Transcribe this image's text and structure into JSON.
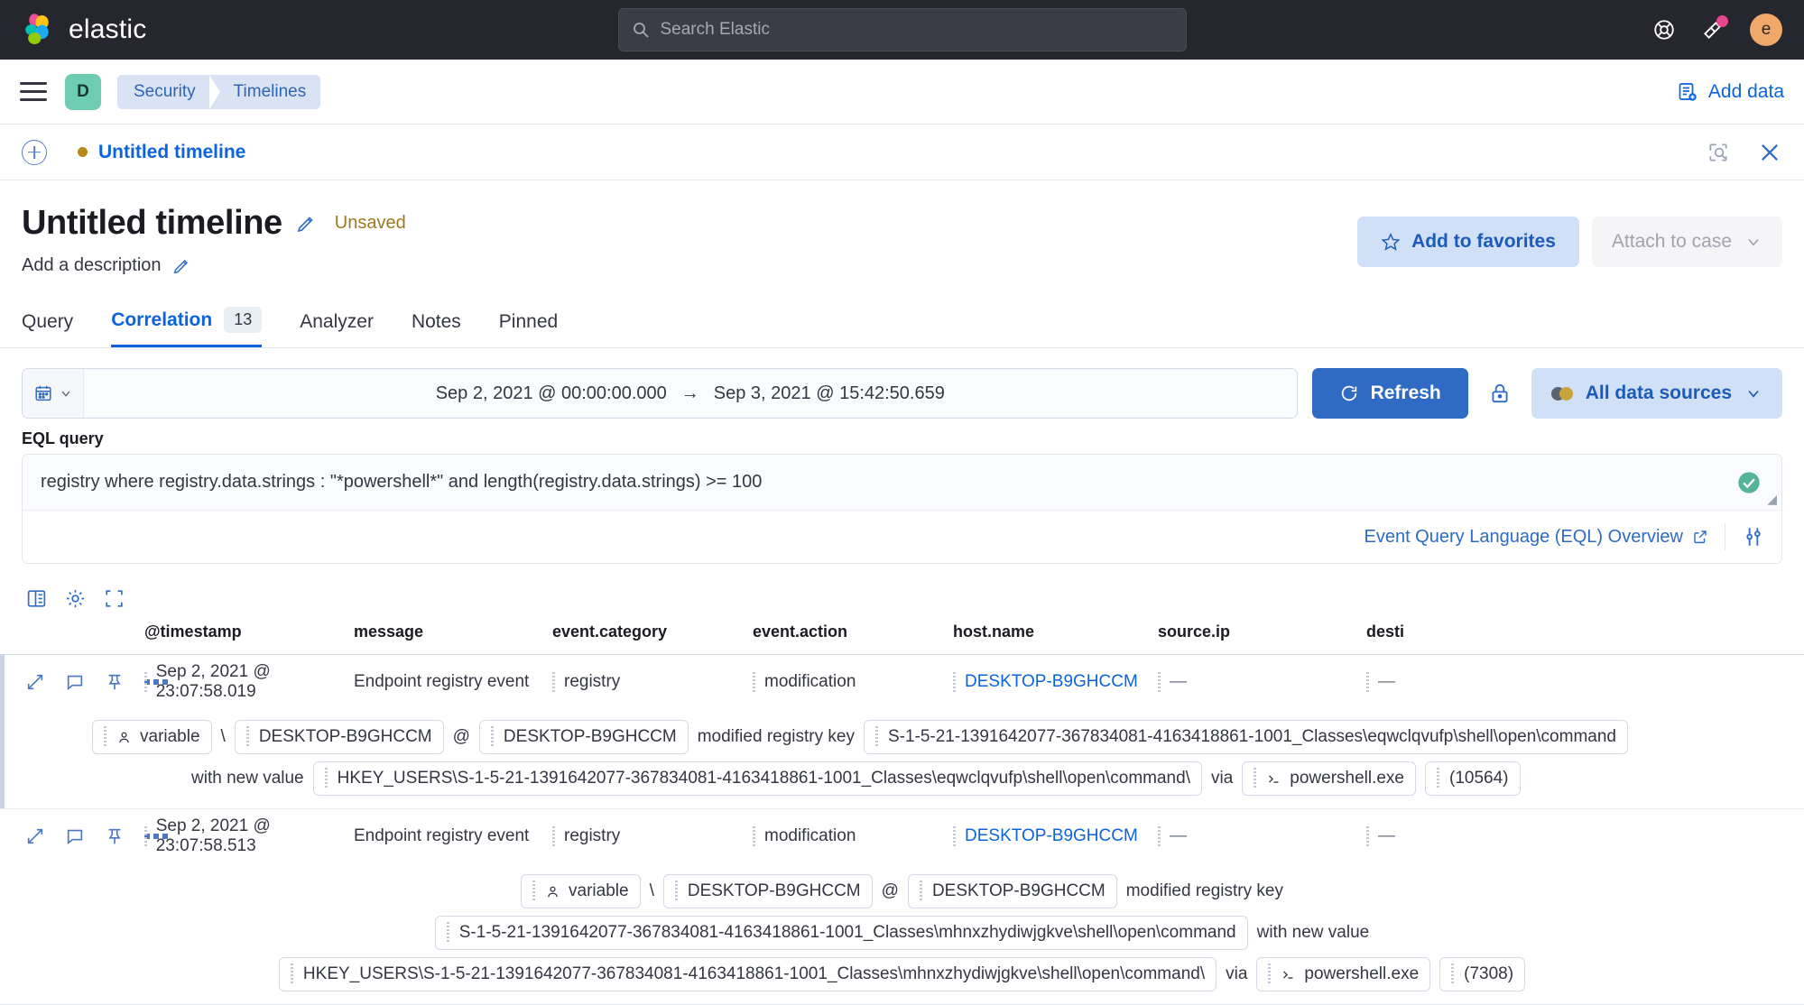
{
  "chrome": {
    "brand": "elastic",
    "search_placeholder": "Search Elastic",
    "help_icon": "lifebuoy-icon",
    "news_icon": "megaphone-icon",
    "avatar_initial": "e"
  },
  "breadcrumb_bar": {
    "menu_icon": "hamburger-menu-icon",
    "space_initial": "D",
    "crumbs": [
      "Security",
      "Timelines"
    ],
    "add_data_label": "Add data",
    "add_data_icon": "add-data-icon"
  },
  "timeline_bar": {
    "new_icon": "plus-circle-icon",
    "name": "Untitled timeline",
    "inspect_icon": "inspect-icon",
    "close_icon": "close-icon"
  },
  "header": {
    "title": "Untitled timeline",
    "title_edit_icon": "pencil-icon",
    "status": "Unsaved",
    "description_placeholder": "Add a description",
    "description_edit_icon": "pencil-icon",
    "favorites_label": "Add to favorites",
    "favorites_icon": "star-icon",
    "attach_case_label": "Attach to case",
    "attach_case_icon": "chevron-down-icon"
  },
  "tabs": [
    {
      "label": "Query",
      "count": null,
      "active": false
    },
    {
      "label": "Correlation",
      "count": "13",
      "active": true
    },
    {
      "label": "Analyzer",
      "count": null,
      "active": false
    },
    {
      "label": "Notes",
      "count": null,
      "active": false
    },
    {
      "label": "Pinned",
      "count": null,
      "active": false
    }
  ],
  "query_bar": {
    "calendar_icon": "calendar-icon",
    "calendar_chevron": "chevron-down-icon",
    "date_start": "Sep 2, 2021 @ 00:00:00.000",
    "date_arrow": "→",
    "date_end": "Sep 3, 2021 @ 15:42:50.659",
    "refresh_label": "Refresh",
    "refresh_icon": "refresh-icon",
    "lock_icon": "lock-icon",
    "sources_label": "All data sources",
    "sources_icon": "partial-circles-icon",
    "sources_chevron": "chevron-down-icon"
  },
  "eql": {
    "label": "EQL query",
    "query": "registry where  registry.data.strings : \"*powershell*\" and length(registry.data.strings) >= 100",
    "valid_icon": "valid-check-icon",
    "resize_icon": "resize-handle-icon",
    "overview_link": "Event Query Language (EQL) Overview",
    "external_icon": "external-link-icon",
    "settings_icon": "query-settings-icon"
  },
  "table": {
    "tools": [
      "columns-icon",
      "gear-icon",
      "fullscreen-icon"
    ],
    "columns": [
      "@timestamp",
      "message",
      "event.category",
      "event.action",
      "host.name",
      "source.ip",
      "desti"
    ],
    "rows": [
      {
        "actions": [
          "expand-icon",
          "comment-icon",
          "pin-icon",
          "more-actions-icon"
        ],
        "timestamp": "Sep 2, 2021 @ 23:07:58.019",
        "message": "Endpoint registry event",
        "event_category": "registry",
        "event_action": "modification",
        "host_name": "DESKTOP-B9GHCCM",
        "source_ip": "—",
        "destination": "—",
        "detail": {
          "user_icon": "user-icon",
          "user": "variable",
          "sep": "\\",
          "host": "DESKTOP-B9GHCCM",
          "at": "@",
          "host2": "DESKTOP-B9GHCCM",
          "verb": "modified registry key",
          "registry_key": "S-1-5-21-1391642077-367834081-4163418861-1001_Classes\\eqwclqvufp\\shell\\open\\command",
          "with_new_value": "with new value",
          "new_value": "HKEY_USERS\\S-1-5-21-1391642077-367834081-4163418861-1001_Classes\\eqwclqvufp\\shell\\open\\command\\",
          "via": "via",
          "process_icon": "terminal-icon",
          "process": "powershell.exe",
          "pid": "(10564)"
        }
      },
      {
        "actions": [
          "expand-icon",
          "comment-icon",
          "pin-icon",
          "more-actions-icon"
        ],
        "timestamp": "Sep 2, 2021 @ 23:07:58.513",
        "message": "Endpoint registry event",
        "event_category": "registry",
        "event_action": "modification",
        "host_name": "DESKTOP-B9GHCCM",
        "source_ip": "—",
        "destination": "—",
        "detail": {
          "user_icon": "user-icon",
          "user": "variable",
          "sep": "\\",
          "host": "DESKTOP-B9GHCCM",
          "at": "@",
          "host2": "DESKTOP-B9GHCCM",
          "verb": "modified registry key",
          "registry_key": "S-1-5-21-1391642077-367834081-4163418861-1001_Classes\\mhnxzhydiwjgkve\\shell\\open\\command",
          "with_new_value": "with new value",
          "new_value": "HKEY_USERS\\S-1-5-21-1391642077-367834081-4163418861-1001_Classes\\mhnxzhydiwjgkve\\shell\\open\\command\\",
          "via": "via",
          "process_icon": "terminal-icon",
          "process": "powershell.exe",
          "pid": "(7308)"
        }
      }
    ]
  },
  "colors": {
    "accent_blue": "#0b64dd",
    "primary_button": "#2f6bc4",
    "chrome_dark": "#25262e",
    "space_badge": "#6dccb1",
    "unsaved": "#9b7a24",
    "avatar": "#f0a96b"
  }
}
